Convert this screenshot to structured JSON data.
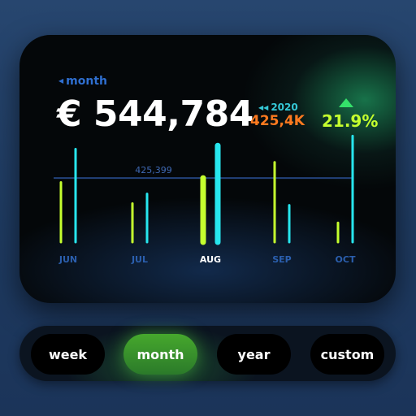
{
  "summary": {
    "period_label": "month",
    "total": "€ 544,784",
    "previous_year_label": "2020",
    "previous_value": "425,4K",
    "change_percent": "21.9%"
  },
  "colors": {
    "lime": "#c5ff2e",
    "cyan": "#27e6ee",
    "orange": "#ff7a1f",
    "accent_blue": "#2f6fd0",
    "up_green": "#35e06a"
  },
  "icons": {
    "period": "caret-left-icon",
    "previous_year": "double-chevron-left-icon",
    "trend": "triangle-up-icon"
  },
  "chart_data": {
    "type": "bar",
    "categories": [
      "JUN",
      "JUL",
      "AUG",
      "SEP",
      "OCT"
    ],
    "highlight": "AUG",
    "series": [
      {
        "values": [
          68,
          44,
          73,
          91,
          22
        ]
      },
      {
        "values": [
          106,
          55,
          110,
          42,
          121
        ]
      }
    ],
    "reference_line": {
      "value": 73,
      "label": "425,399"
    },
    "ylim": [
      0,
      125
    ]
  },
  "segments": [
    {
      "label": "week",
      "active": false
    },
    {
      "label": "month",
      "active": true
    },
    {
      "label": "year",
      "active": false
    },
    {
      "label": "custom",
      "active": false
    }
  ]
}
